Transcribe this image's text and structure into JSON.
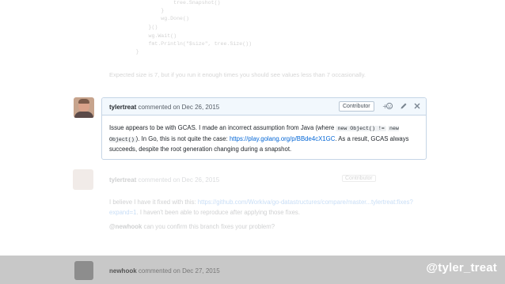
{
  "code_snippet": {
    "lines": [
      "                    tree.Snapshot()",
      "                }",
      "                wg.Done()",
      "            }()",
      "            wg.Wait()",
      "            fmt.Println(\"$size\", tree.Size())",
      "        }"
    ],
    "caption": "Expected size is 7, but if you run it enough times you should see values less than 7 occasionally."
  },
  "comment_main": {
    "author": "tylertreat",
    "action": "commented on",
    "date": "Dec 26, 2015",
    "badge": "Contributor",
    "body": {
      "p1": "Issue appears to be with GCAS. I made an incorrect assumption from Java (where ",
      "code1": "new Object() !=",
      "code2": "new Object()",
      "p2": "). In Go, this is not quite the case: ",
      "link": "https://play.golang.org/p/BBde4cX1GC",
      "p3": ". As a result, GCAS always succeeds, despite the root generation changing during a snapshot."
    }
  },
  "comment_second": {
    "author": "tylertreat",
    "action": "commented on",
    "date": "Dec 26, 2015",
    "badge": "Contributor",
    "body_p1_a": "I believe I have it fixed with this: ",
    "body_p1_link": "https://github.com/Workiva/go-datastructures/compare/master...tylertreat:fixes?expand=1",
    "body_p1_b": ". I haven't been able to reproduce after applying those fixes.",
    "body_p2_mention": "@newhook",
    "body_p2_rest": " can you confirm this branch fixes your problem?"
  },
  "comment_third": {
    "author": "newhook",
    "action": "commented on",
    "date": "Dec 27, 2015"
  },
  "overlay_handle": "@tyler_treat",
  "icons": [
    "emoji-reaction-icon",
    "edit-pencil-icon",
    "close-icon"
  ],
  "colors": {
    "header_bg": "#f2f8fd",
    "border": "#c5d5e6",
    "link": "#0366d6",
    "handle": "#ffffff",
    "strip": "#c8c8c8"
  }
}
